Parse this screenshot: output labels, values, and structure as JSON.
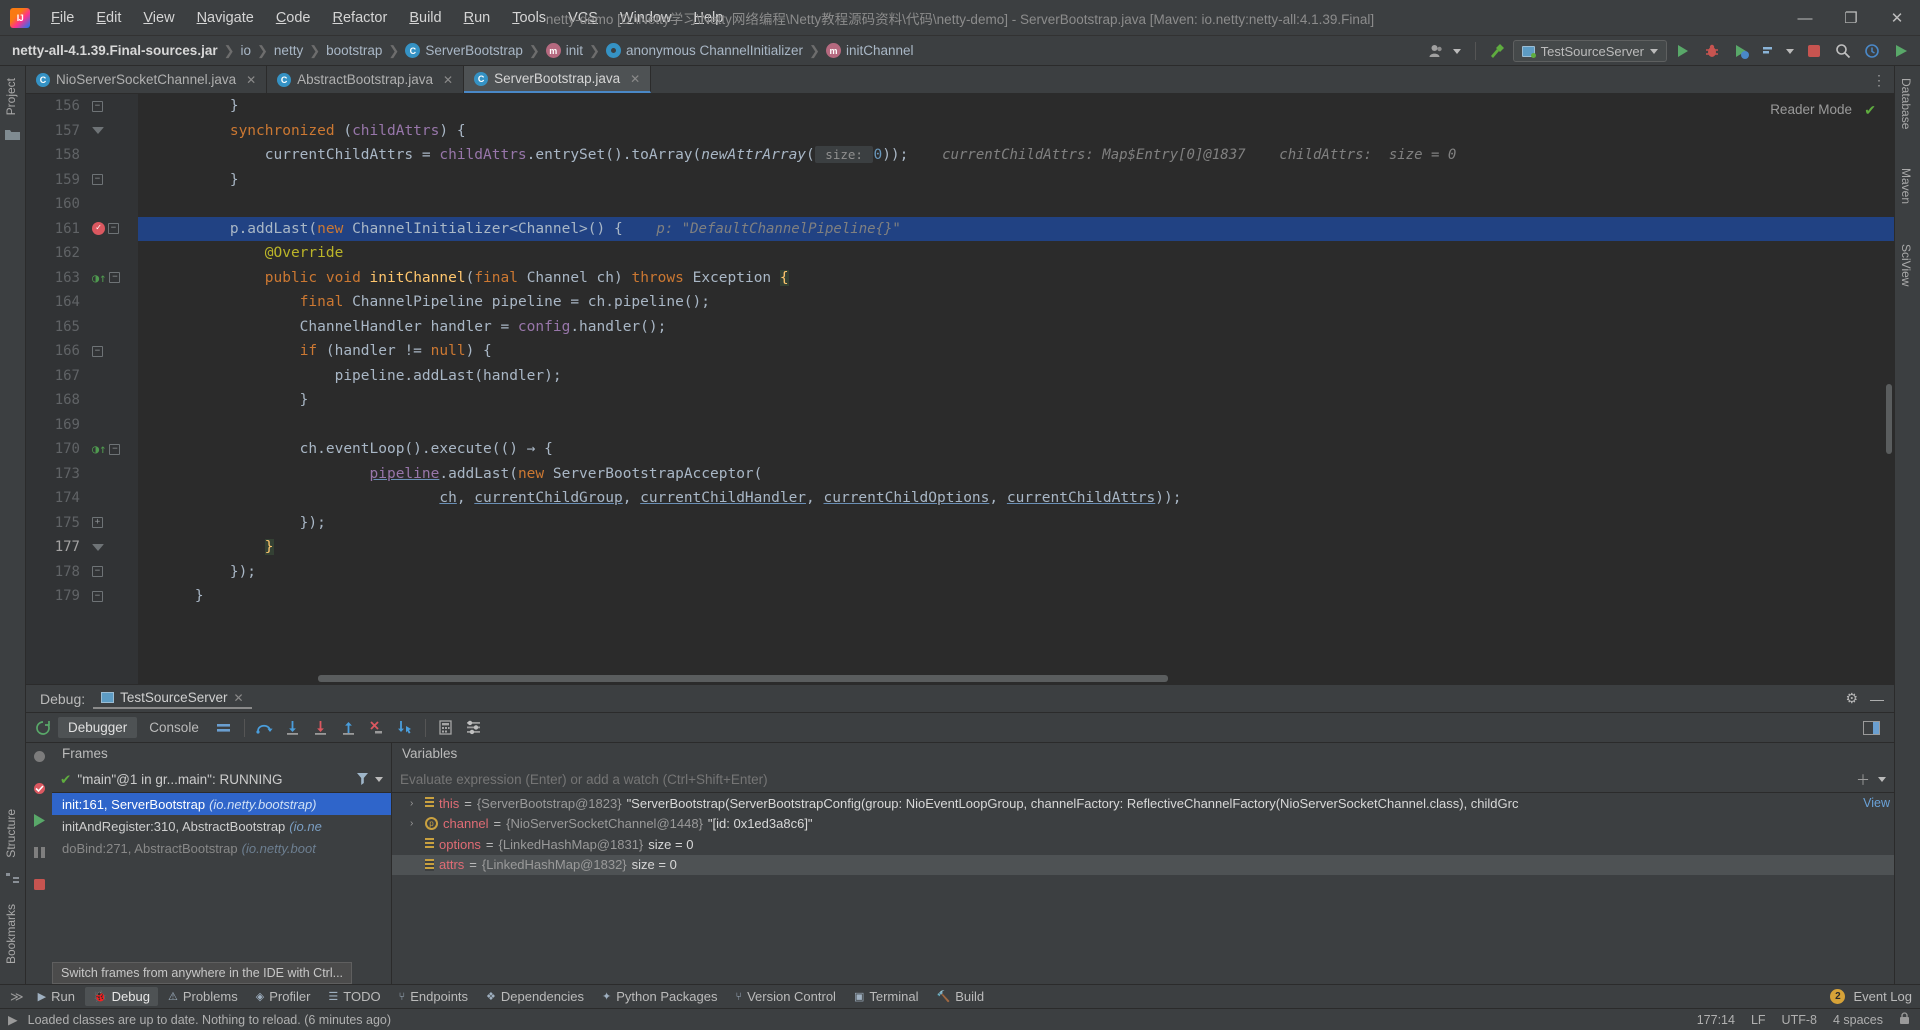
{
  "window": {
    "title": "netty-demo [D:\\Netty学习\\Netty网络编程\\Netty教程源码资料\\代码\\netty-demo] - ServerBootstrap.java [Maven: io.netty:netty-all:4.1.39.Final]",
    "minimize": "—",
    "maximize": "❐",
    "close": "✕"
  },
  "menu": [
    "File",
    "Edit",
    "View",
    "Navigate",
    "Code",
    "Refactor",
    "Build",
    "Run",
    "Tools",
    "VCS",
    "Window",
    "Help"
  ],
  "breadcrumb": [
    {
      "label": "netty-all-4.1.39.Final-sources.jar",
      "icon": null
    },
    {
      "label": "io",
      "icon": null
    },
    {
      "label": "netty",
      "icon": null
    },
    {
      "label": "bootstrap",
      "icon": null
    },
    {
      "label": "ServerBootstrap",
      "icon": "class-icon",
      "glyph": "C"
    },
    {
      "label": "init",
      "icon": "method-icon",
      "glyph": "m"
    },
    {
      "label": "anonymous ChannelInitializer",
      "icon": "anonymous-class-icon",
      "glyph": ""
    },
    {
      "label": "initChannel",
      "icon": "method-icon",
      "glyph": "m"
    }
  ],
  "toolbar": {
    "run_config": "TestSourceServer",
    "search_icon": "search-icon",
    "run_icon": "run-icon",
    "debug_icon": "debug-icon",
    "coverage_icon": "run-with-coverage-icon",
    "stop_icon": "stop-icon",
    "updates_icon": "updates-icon",
    "profiler_icon": "profiler-icon",
    "user_icon": "user-icon",
    "build_icon": "hammer-icon"
  },
  "editor_tabs": [
    {
      "label": "NioServerSocketChannel.java",
      "active": false
    },
    {
      "label": "AbstractBootstrap.java",
      "active": false
    },
    {
      "label": "ServerBootstrap.java",
      "active": true
    }
  ],
  "editor": {
    "reader_mode": "Reader Mode",
    "lines": [
      {
        "num": "156",
        "fold": "square",
        "indent": 0,
        "parts": [
          {
            "t": "        }",
            "c": "plain"
          }
        ]
      },
      {
        "num": "157",
        "fold": "down",
        "indent": 0,
        "parts": [
          {
            "t": "        ",
            "c": "plain"
          },
          {
            "t": "synchronized",
            "c": "kw"
          },
          {
            "t": " (",
            "c": "plain"
          },
          {
            "t": "childAttrs",
            "c": "fld"
          },
          {
            "t": ") {",
            "c": "plain"
          }
        ]
      },
      {
        "num": "158",
        "fold": null,
        "indent": 0,
        "parts": [
          {
            "t": "            currentChildAttrs = ",
            "c": "plain"
          },
          {
            "t": "childAttrs",
            "c": "fld"
          },
          {
            "t": ".entrySet().toArray(",
            "c": "plain"
          },
          {
            "t": "newAttrArray",
            "c": "italic"
          },
          {
            "t": "(",
            "c": "plain"
          },
          {
            "t": " size: ",
            "c": "param"
          },
          {
            "t": "0",
            "c": "num"
          },
          {
            "t": "));",
            "c": "plain"
          }
        ],
        "hint": "currentChildAttrs: Map$Entry[0]@1837    childAttrs:  size = 0"
      },
      {
        "num": "159",
        "fold": "square",
        "indent": 0,
        "parts": [
          {
            "t": "        }",
            "c": "plain"
          }
        ]
      },
      {
        "num": "160",
        "fold": null,
        "indent": 0,
        "parts": []
      },
      {
        "num": "161",
        "fold": "square",
        "indent": 0,
        "highlight": true,
        "breakpoint": true,
        "parts": [
          {
            "t": "        p.addLast(",
            "c": "plain"
          },
          {
            "t": "new",
            "c": "kw"
          },
          {
            "t": " ChannelInitializer<Channel>() {",
            "c": "plain"
          }
        ],
        "hint": "p: \"DefaultChannelPipeline{}\""
      },
      {
        "num": "162",
        "fold": null,
        "indent": 0,
        "parts": [
          {
            "t": "            ",
            "c": "plain"
          },
          {
            "t": "@Override",
            "c": "ann"
          }
        ]
      },
      {
        "num": "163",
        "fold": "square",
        "indent": 0,
        "runmark": true,
        "parts": [
          {
            "t": "            ",
            "c": "plain"
          },
          {
            "t": "public",
            "c": "kw"
          },
          {
            "t": " ",
            "c": "plain"
          },
          {
            "t": "void",
            "c": "kw"
          },
          {
            "t": " ",
            "c": "plain"
          },
          {
            "t": "initChannel",
            "c": "mth"
          },
          {
            "t": "(",
            "c": "plain"
          },
          {
            "t": "final",
            "c": "kw"
          },
          {
            "t": " Channel ch) ",
            "c": "plain"
          },
          {
            "t": "throws",
            "c": "kw"
          },
          {
            "t": " Exception ",
            "c": "plain"
          },
          {
            "t": "{",
            "c": "execbrace"
          }
        ]
      },
      {
        "num": "164",
        "fold": null,
        "indent": 0,
        "parts": [
          {
            "t": "                ",
            "c": "plain"
          },
          {
            "t": "final",
            "c": "kw"
          },
          {
            "t": " ChannelPipeline pipeline = ch.pipeline();",
            "c": "plain"
          }
        ]
      },
      {
        "num": "165",
        "fold": null,
        "indent": 0,
        "parts": [
          {
            "t": "                ChannelHandler handler = ",
            "c": "plain"
          },
          {
            "t": "config",
            "c": "fld"
          },
          {
            "t": ".handler();",
            "c": "plain"
          }
        ]
      },
      {
        "num": "166",
        "fold": "square",
        "indent": 0,
        "parts": [
          {
            "t": "                ",
            "c": "plain"
          },
          {
            "t": "if",
            "c": "kw"
          },
          {
            "t": " (handler != ",
            "c": "plain"
          },
          {
            "t": "null",
            "c": "kw"
          },
          {
            "t": ") {",
            "c": "plain"
          }
        ]
      },
      {
        "num": "167",
        "fold": null,
        "indent": 0,
        "parts": [
          {
            "t": "                    pipeline.addLast(handler);",
            "c": "plain"
          }
        ]
      },
      {
        "num": "168",
        "fold": null,
        "indent": 0,
        "parts": [
          {
            "t": "                }",
            "c": "plain"
          }
        ]
      },
      {
        "num": "169",
        "fold": null,
        "indent": 0,
        "parts": []
      },
      {
        "num": "170",
        "fold": "square",
        "indent": 0,
        "runmark": true,
        "parts": [
          {
            "t": "                ch.eventLoop().execute(() ",
            "c": "plain"
          },
          {
            "t": "→",
            "c": "plain"
          },
          {
            "t": " {",
            "c": "plain"
          }
        ]
      },
      {
        "num": "173",
        "fold": null,
        "indent": 0,
        "parts": [
          {
            "t": "                        ",
            "c": "plain"
          },
          {
            "t": "pipeline",
            "c": "fld-ul"
          },
          {
            "t": ".addLast(",
            "c": "plain"
          },
          {
            "t": "new",
            "c": "kw"
          },
          {
            "t": " ServerBootstrapAcceptor(",
            "c": "plain"
          }
        ]
      },
      {
        "num": "174",
        "fold": null,
        "indent": 0,
        "parts": [
          {
            "t": "                                ",
            "c": "plain"
          },
          {
            "t": "ch",
            "c": "ul"
          },
          {
            "t": ", ",
            "c": "plain"
          },
          {
            "t": "currentChildGroup",
            "c": "ul"
          },
          {
            "t": ", ",
            "c": "plain"
          },
          {
            "t": "currentChildHandler",
            "c": "ul"
          },
          {
            "t": ", ",
            "c": "plain"
          },
          {
            "t": "currentChildOptions",
            "c": "ul"
          },
          {
            "t": ", ",
            "c": "plain"
          },
          {
            "t": "currentChildAttrs",
            "c": "ul"
          },
          {
            "t": "));",
            "c": "plain"
          }
        ]
      },
      {
        "num": "175",
        "fold": "plus",
        "indent": 0,
        "parts": [
          {
            "t": "                });",
            "c": "plain"
          }
        ]
      },
      {
        "num": "177",
        "fold": "down",
        "indent": 0,
        "current": true,
        "parts": [
          {
            "t": "            ",
            "c": "plain"
          },
          {
            "t": "}",
            "c": "execbrace"
          }
        ]
      },
      {
        "num": "178",
        "fold": "square",
        "indent": 0,
        "parts": [
          {
            "t": "        });",
            "c": "plain"
          }
        ]
      },
      {
        "num": "179",
        "fold": "square",
        "indent": 0,
        "parts": [
          {
            "t": "    }",
            "c": "plain"
          }
        ]
      }
    ]
  },
  "debug": {
    "label": "Debug:",
    "session": "TestSourceServer",
    "tabs": [
      "Debugger",
      "Console"
    ],
    "active_tab": "Debugger",
    "settings_icon": "gear-icon",
    "minimize_icon": "minimize-icon",
    "buttons": [
      {
        "name": "rerun-icon",
        "glyph": "⟳"
      },
      {
        "name": "step-over-icon",
        "glyph": "⤼"
      },
      {
        "name": "step-into-icon",
        "glyph": "↓"
      },
      {
        "name": "force-step-into-icon",
        "glyph": "↓"
      },
      {
        "name": "step-out-icon",
        "glyph": "↑"
      },
      {
        "name": "drop-frame-icon",
        "glyph": "✗"
      },
      {
        "name": "run-to-cursor-icon",
        "glyph": "↳"
      },
      {
        "name": "evaluate-expression-icon",
        "glyph": "▤"
      },
      {
        "name": "settings-icon",
        "glyph": "⚙"
      }
    ],
    "frames": {
      "title": "Frames",
      "thread": "\"main\"@1 in gr...main\": RUNNING",
      "filter_icon": "filter-icon",
      "dropdown_icon": "chevron-down-icon",
      "list": [
        {
          "method": "init:161, ServerBootstrap",
          "pkg": "(io.netty.bootstrap)",
          "selected": true
        },
        {
          "method": "initAndRegister:310, AbstractBootstrap",
          "pkg": "(io.ne",
          "selected": false
        },
        {
          "method": "doBind:271, AbstractBootstrap",
          "pkg": "(io.netty.boot",
          "selected": false
        }
      ],
      "tooltip": "Switch frames from anywhere in the IDE with Ctrl..."
    },
    "variables": {
      "title": "Variables",
      "watch_placeholder": "Evaluate expression (Enter) or add a watch (Ctrl+Shift+Enter)",
      "add_icon": "plus-icon",
      "view_link": "View",
      "rows": [
        {
          "expand": "›",
          "icon": "field-icon",
          "name": "this",
          "value_type": "{ServerBootstrap@1823}",
          "value": "\"ServerBootstrap(ServerBootstrapConfig(group: NioEventLoopGroup, channelFactory: ReflectiveChannelFactory(NioServerSocketChannel.class), childGrc",
          "selected": false
        },
        {
          "expand": "›",
          "icon": "param-icon",
          "name": "channel",
          "value_type": "{NioServerSocketChannel@1448}",
          "value": "\"[id: 0x1ed3a8c6]\"",
          "selected": false
        },
        {
          "expand": "",
          "icon": "field-icon",
          "name": "options",
          "value_type": "{LinkedHashMap@1831}",
          "value": "size = 0",
          "selected": false
        },
        {
          "expand": "",
          "icon": "field-icon",
          "name": "attrs",
          "value_type": "{LinkedHashMap@1832}",
          "value": "size = 0",
          "selected": true
        }
      ]
    }
  },
  "left_strip": [
    {
      "label": "Project",
      "name": "tool-window-project"
    },
    {
      "label": "Structure",
      "name": "tool-window-structure"
    },
    {
      "label": "Bookmarks",
      "name": "tool-window-bookmarks"
    }
  ],
  "right_strip": [
    {
      "label": "Database",
      "name": "tool-window-database"
    },
    {
      "label": "Maven",
      "name": "tool-window-maven"
    },
    {
      "label": "SciView",
      "name": "tool-window-sciview"
    }
  ],
  "bottom_toolwindows": [
    {
      "label": "Run",
      "icon": "run-icon",
      "active": false
    },
    {
      "label": "Debug",
      "icon": "debug-icon",
      "active": true
    },
    {
      "label": "Problems",
      "icon": "problems-icon",
      "active": false
    },
    {
      "label": "Profiler",
      "icon": "profiler-icon",
      "active": false
    },
    {
      "label": "TODO",
      "icon": "todo-icon",
      "active": false
    },
    {
      "label": "Endpoints",
      "icon": "endpoints-icon",
      "active": false
    },
    {
      "label": "Dependencies",
      "icon": "dependencies-icon",
      "active": false
    },
    {
      "label": "Python Packages",
      "icon": "python-icon",
      "active": false
    },
    {
      "label": "Version Control",
      "icon": "vcs-icon",
      "active": false
    },
    {
      "label": "Terminal",
      "icon": "terminal-icon",
      "active": false
    },
    {
      "label": "Build",
      "icon": "build-icon",
      "active": false
    }
  ],
  "event_log": {
    "label": "Event Log",
    "count": "2"
  },
  "statusbar": {
    "message": "Loaded classes are up to date. Nothing to reload. (6 minutes ago)",
    "position": "177:14",
    "line_separator": "LF",
    "encoding": "UTF-8",
    "indent": "4 spaces",
    "lock_icon": "lock-icon"
  }
}
